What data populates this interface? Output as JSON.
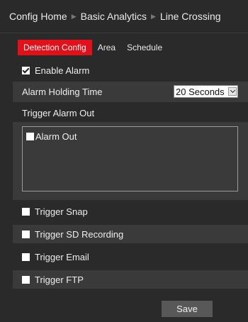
{
  "breadcrumb": {
    "items": [
      "Config Home",
      "Basic Analytics",
      "Line Crossing"
    ]
  },
  "tabs": [
    {
      "label": "Detection Config",
      "active": true
    },
    {
      "label": "Area",
      "active": false
    },
    {
      "label": "Schedule",
      "active": false
    }
  ],
  "enable_alarm": {
    "label": "Enable Alarm",
    "checked": true
  },
  "alarm_holding_time": {
    "label": "Alarm Holding Time",
    "value": "20 Seconds"
  },
  "trigger_alarm_out": {
    "label": "Trigger Alarm Out",
    "items": [
      {
        "label": "Alarm Out",
        "checked": false
      }
    ]
  },
  "triggers": {
    "snap": {
      "label": "Trigger Snap",
      "checked": false
    },
    "sd_recording": {
      "label": "Trigger SD Recording",
      "checked": false
    },
    "email": {
      "label": "Trigger Email",
      "checked": false
    },
    "ftp": {
      "label": "Trigger FTP",
      "checked": false
    }
  },
  "save_label": "Save",
  "colors": {
    "active_tab": "#e3101a",
    "background": "#2a2a2a",
    "row_shade": "#3a3a3a",
    "button": "#585858"
  }
}
